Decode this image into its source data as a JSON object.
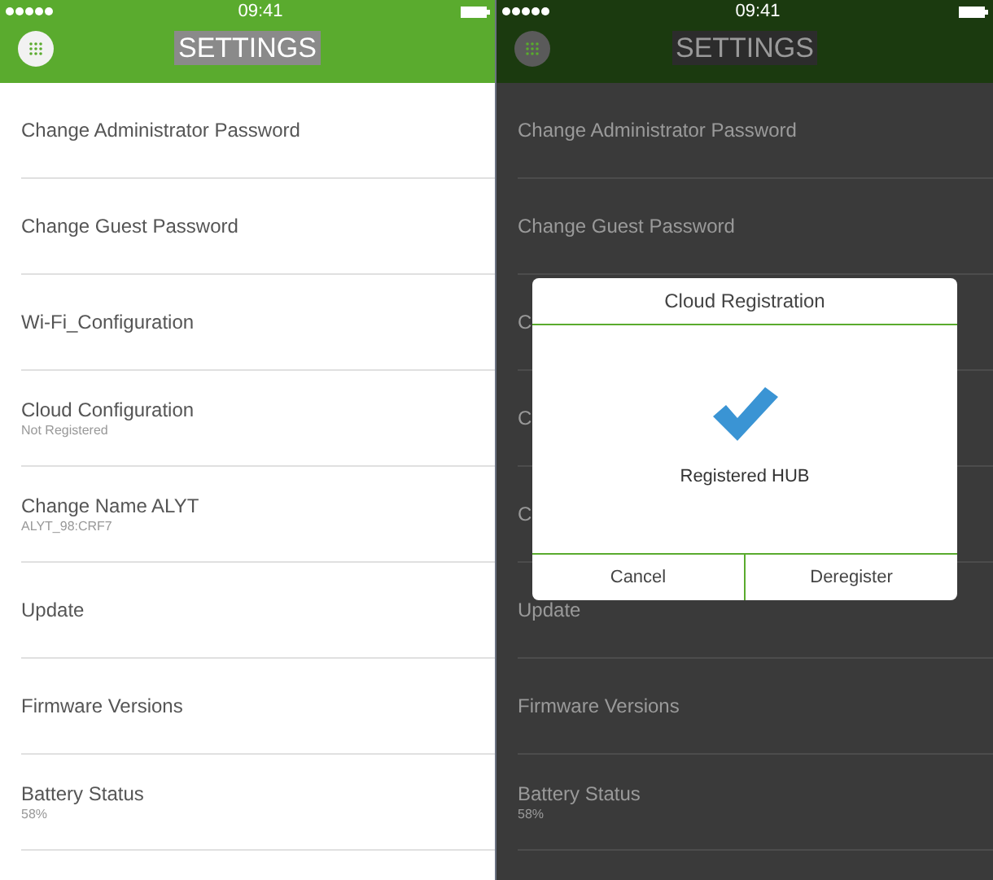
{
  "screens": [
    {
      "status_bar": {
        "time": "09:41"
      },
      "title": "SETTINGS",
      "dimmed": false,
      "items": [
        {
          "label": "Change Administrator Password"
        },
        {
          "label": "Change Guest Password"
        },
        {
          "label": "Wi-Fi_Configuration"
        },
        {
          "label": "Cloud Configuration",
          "subtitle": "Not Registered"
        },
        {
          "label": "Change Name ALYT",
          "subtitle": "ALYT_98:CRF7"
        },
        {
          "label": "Update"
        },
        {
          "label": "Firmware Versions"
        },
        {
          "label": "Battery Status",
          "subtitle": "58%"
        }
      ]
    },
    {
      "status_bar": {
        "time": "09:41"
      },
      "title": "SETTINGS",
      "dimmed": true,
      "items": [
        {
          "label": "Change Administrator Password"
        },
        {
          "label": "Change Guest Password"
        },
        {
          "label": "C"
        },
        {
          "label": "C"
        },
        {
          "label": "C"
        },
        {
          "label": "Update"
        },
        {
          "label": "Firmware Versions"
        },
        {
          "label": "Battery Status",
          "subtitle": "58%"
        }
      ],
      "dialog": {
        "title": "Cloud Registration",
        "message": "Registered HUB",
        "buttons": [
          "Cancel",
          "Deregister"
        ]
      }
    }
  ]
}
